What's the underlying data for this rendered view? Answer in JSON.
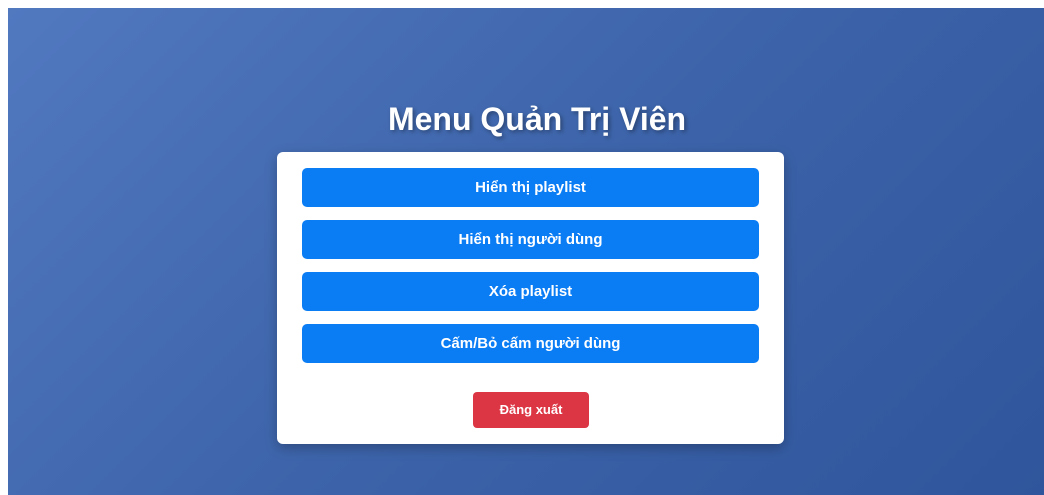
{
  "page": {
    "title": "Menu Quản Trị Viên"
  },
  "menu": {
    "buttons": [
      {
        "label": "Hiển thị playlist"
      },
      {
        "label": "Hiển thị người dùng"
      },
      {
        "label": "Xóa playlist"
      },
      {
        "label": "Cấm/Bỏ cấm người dùng"
      }
    ],
    "logout_label": "Đăng xuất"
  },
  "colors": {
    "background_gradient_start": "#5179c0",
    "background_gradient_end": "#2f559c",
    "primary_button": "#0a7cf4",
    "logout_button": "#dc3645",
    "card": "#ffffff"
  }
}
